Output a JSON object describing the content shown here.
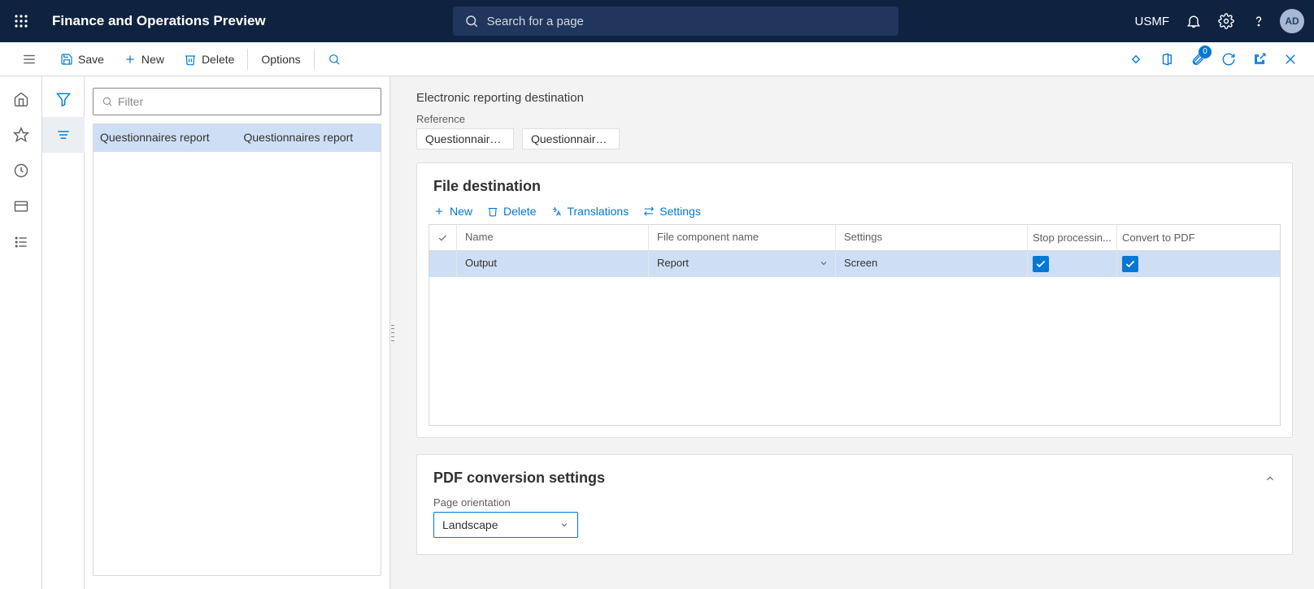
{
  "topbar": {
    "title": "Finance and Operations Preview",
    "search_placeholder": "Search for a page",
    "company": "USMF",
    "avatar": "AD"
  },
  "actionbar": {
    "save": "Save",
    "new": "New",
    "delete": "Delete",
    "options": "Options",
    "attachments_badge": "0"
  },
  "listpane": {
    "filter_placeholder": "Filter",
    "rows": [
      {
        "col1": "Questionnaires report",
        "col2": "Questionnaires report"
      }
    ]
  },
  "main": {
    "page_title": "Electronic reporting destination",
    "reference_label": "Reference",
    "reference_values": [
      "Questionnaire...",
      "Questionnaire..."
    ],
    "file_destination": {
      "heading": "File destination",
      "toolbar": {
        "new": "New",
        "delete": "Delete",
        "translations": "Translations",
        "settings": "Settings"
      },
      "columns": {
        "name": "Name",
        "file_component": "File component name",
        "settings": "Settings",
        "stop_processing": "Stop processin...",
        "convert_to_pdf": "Convert to PDF"
      },
      "rows": [
        {
          "name": "Output",
          "file_component": "Report",
          "settings": "Screen",
          "stop_processing": true,
          "convert_to_pdf": true
        }
      ]
    },
    "pdf_conversion": {
      "heading": "PDF conversion settings",
      "page_orientation_label": "Page orientation",
      "page_orientation_value": "Landscape"
    }
  }
}
